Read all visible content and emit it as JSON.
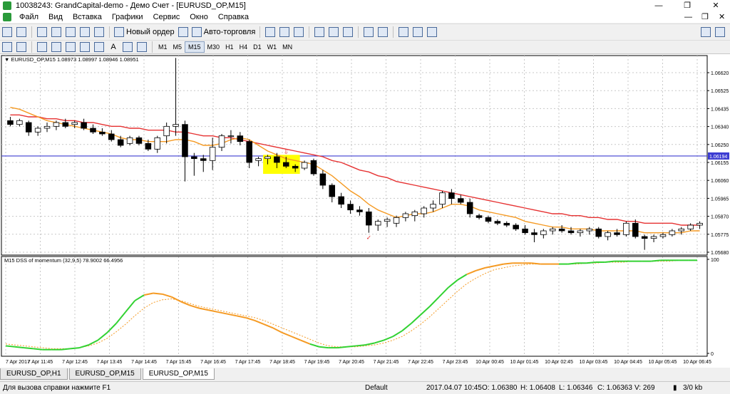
{
  "window": {
    "title": "10038243: GrandCapital-demo - Демо Счет - [EURUSD_OP,M15]",
    "minimize": "—",
    "maximize": "❐",
    "close": "✕"
  },
  "menu": {
    "items": [
      "Файл",
      "Вид",
      "Вставка",
      "Графики",
      "Сервис",
      "Окно",
      "Справка"
    ],
    "right_min": "—",
    "right_restore": "❐",
    "right_close": "✕"
  },
  "toolbar": {
    "new_order": "Новый ордер",
    "auto_trading": "Авто-торговля",
    "timeframes": [
      "M1",
      "M5",
      "M15",
      "M30",
      "H1",
      "H4",
      "D1",
      "W1",
      "MN"
    ],
    "draw_text_tool": "A"
  },
  "colors": {
    "bull": "#ffffff",
    "bear": "#000000",
    "ma_fast": "#f59a23",
    "ma_slow": "#e63232",
    "hline": "#3c3cd2",
    "osc_main_green": "#32d232",
    "osc_main_orange": "#f59a23",
    "highlight": "#ffff00"
  },
  "chart_data": [
    {
      "type": "candlestick",
      "title": "EURUSD_OP,M15",
      "ohlc_header": "1.08973 1.08997 1.08946 1.08951",
      "ylim": [
        1.0568,
        1.067
      ],
      "y_ticks": [
        "1.06620",
        "1.06525",
        "1.06435",
        "1.06340",
        "1.06250",
        "1.06155",
        "1.06060",
        "1.05965",
        "1.05870",
        "1.05775",
        "1.05680"
      ],
      "hline_value": "1.06194",
      "candles": [
        [
          1.0638,
          1.064,
          1.0635,
          1.0636
        ],
        [
          1.0636,
          1.0639,
          1.0635,
          1.0638
        ],
        [
          1.0637,
          1.0638,
          1.063,
          1.0632
        ],
        [
          1.0632,
          1.0635,
          1.063,
          1.0634
        ],
        [
          1.0634,
          1.0637,
          1.0632,
          1.0635
        ],
        [
          1.0635,
          1.0638,
          1.0633,
          1.0637
        ],
        [
          1.0637,
          1.0639,
          1.0634,
          1.0635
        ],
        [
          1.0636,
          1.0638,
          1.0634,
          1.0637
        ],
        [
          1.0637,
          1.0639,
          1.0633,
          1.0634
        ],
        [
          1.0634,
          1.0636,
          1.0631,
          1.0632
        ],
        [
          1.0632,
          1.0634,
          1.063,
          1.0631
        ],
        [
          1.0631,
          1.0633,
          1.0627,
          1.0628
        ],
        [
          1.0628,
          1.063,
          1.0624,
          1.0625
        ],
        [
          1.0626,
          1.063,
          1.0625,
          1.0629
        ],
        [
          1.0629,
          1.063,
          1.0625,
          1.0626
        ],
        [
          1.0626,
          1.0628,
          1.0622,
          1.0623
        ],
        [
          1.0623,
          1.063,
          1.0621,
          1.0629
        ],
        [
          1.063,
          1.0637,
          1.0626,
          1.0635
        ],
        [
          1.0635,
          1.0671,
          1.063,
          1.0636
        ],
        [
          1.0636,
          1.0638,
          1.0606,
          1.0619
        ],
        [
          1.0619,
          1.0621,
          1.0609,
          1.0618
        ],
        [
          1.0618,
          1.062,
          1.0611,
          1.0617
        ],
        [
          1.0617,
          1.0629,
          1.0612,
          1.0624
        ],
        [
          1.0624,
          1.0631,
          1.0622,
          1.063
        ],
        [
          1.063,
          1.0633,
          1.0626,
          1.063
        ],
        [
          1.063,
          1.0632,
          1.0625,
          1.0627
        ],
        [
          1.0627,
          1.0628,
          1.0613,
          1.0616
        ],
        [
          1.0617,
          1.0619,
          1.0614,
          1.0618
        ],
        [
          1.0618,
          1.062,
          1.0615,
          1.0619
        ],
        [
          1.0619,
          1.0621,
          1.0613,
          1.0616
        ],
        [
          1.0616,
          1.0619,
          1.0613,
          1.0614
        ],
        [
          1.0614,
          1.0615,
          1.0611,
          1.0613
        ],
        [
          1.0613,
          1.0617,
          1.0612,
          1.0616
        ],
        [
          1.0617,
          1.0618,
          1.0609,
          1.061
        ],
        [
          1.061,
          1.0612,
          1.0602,
          1.0604
        ],
        [
          1.0604,
          1.0605,
          1.0595,
          1.0598
        ],
        [
          1.0598,
          1.06,
          1.0592,
          1.0594
        ],
        [
          1.0594,
          1.0596,
          1.0589,
          1.0591
        ],
        [
          1.0591,
          1.0593,
          1.0588,
          1.059
        ],
        [
          1.059,
          1.0592,
          1.0579,
          1.0583
        ],
        [
          1.0583,
          1.0586,
          1.058,
          1.0585
        ],
        [
          1.0585,
          1.0587,
          1.0582,
          1.0586
        ],
        [
          1.0584,
          1.0588,
          1.0582,
          1.0587
        ],
        [
          1.0587,
          1.059,
          1.0585,
          1.0589
        ],
        [
          1.0588,
          1.0591,
          1.0585,
          1.059
        ],
        [
          1.0589,
          1.0593,
          1.0587,
          1.0592
        ],
        [
          1.0592,
          1.0596,
          1.059,
          1.0594
        ],
        [
          1.0594,
          1.0601,
          1.0592,
          1.06
        ],
        [
          1.06,
          1.0602,
          1.0594,
          1.0597
        ],
        [
          1.0597,
          1.0599,
          1.0594,
          1.0595
        ],
        [
          1.0595,
          1.0597,
          1.0587,
          1.0589
        ],
        [
          1.0588,
          1.0589,
          1.0586,
          1.0587
        ],
        [
          1.0587,
          1.0588,
          1.0584,
          1.0585
        ],
        [
          1.0585,
          1.0586,
          1.0583,
          1.0584
        ],
        [
          1.0584,
          1.0585,
          1.0582,
          1.0583
        ],
        [
          1.0583,
          1.0584,
          1.058,
          1.0581
        ],
        [
          1.0581,
          1.0583,
          1.0578,
          1.0579
        ],
        [
          1.0579,
          1.0581,
          1.0574,
          1.0578
        ],
        [
          1.0578,
          1.0581,
          1.0576,
          1.058
        ],
        [
          1.058,
          1.0582,
          1.0578,
          1.0581
        ],
        [
          1.0581,
          1.0583,
          1.0579,
          1.058
        ],
        [
          1.058,
          1.0582,
          1.0578,
          1.0579
        ],
        [
          1.0579,
          1.0581,
          1.0577,
          1.058
        ],
        [
          1.058,
          1.0582,
          1.0578,
          1.0581
        ],
        [
          1.0581,
          1.0582,
          1.0576,
          1.0577
        ],
        [
          1.0577,
          1.058,
          1.0575,
          1.0579
        ],
        [
          1.0579,
          1.0581,
          1.0577,
          1.0578
        ],
        [
          1.0578,
          1.0585,
          1.0577,
          1.0584
        ],
        [
          1.0584,
          1.0586,
          1.0576,
          1.0577
        ],
        [
          1.0577,
          1.0578,
          1.057,
          1.0576
        ],
        [
          1.0576,
          1.0578,
          1.0574,
          1.0577
        ],
        [
          1.0577,
          1.0579,
          1.0576,
          1.0578
        ],
        [
          1.0578,
          1.0581,
          1.0577,
          1.058
        ],
        [
          1.058,
          1.0582,
          1.0578,
          1.0581
        ],
        [
          1.0581,
          1.0584,
          1.058,
          1.0583
        ],
        [
          1.0583,
          1.0585,
          1.0581,
          1.0584
        ]
      ],
      "ma_fast": [
        1.0645,
        1.0644,
        1.0642,
        1.064,
        1.0638,
        1.0637,
        1.0636,
        1.0635,
        1.0634,
        1.0633,
        1.0632,
        1.0631,
        1.0629,
        1.0628,
        1.0628,
        1.0627,
        1.0627,
        1.0627,
        1.0628,
        1.0628,
        1.0627,
        1.0625,
        1.0625,
        1.0626,
        1.0628,
        1.0629,
        1.0628,
        1.0625,
        1.0622,
        1.062,
        1.0618,
        1.0617,
        1.0616,
        1.0615,
        1.0612,
        1.0609,
        1.0605,
        1.0601,
        1.0598,
        1.0594,
        1.0591,
        1.0589,
        1.0587,
        1.0588,
        1.0589,
        1.0589,
        1.059,
        1.0592,
        1.0594,
        1.0594,
        1.0593,
        1.0591,
        1.059,
        1.0589,
        1.0588,
        1.0587,
        1.0585,
        1.0584,
        1.0583,
        1.0582,
        1.0582,
        1.0581,
        1.0581,
        1.0581,
        1.058,
        1.058,
        1.058,
        1.058,
        1.058,
        1.0579,
        1.0579,
        1.0579,
        1.0579,
        1.0579,
        1.058,
        1.058
      ],
      "ma_slow": [
        1.0641,
        1.0641,
        1.064,
        1.064,
        1.0639,
        1.0639,
        1.0638,
        1.0638,
        1.0637,
        1.0637,
        1.0636,
        1.0635,
        1.0635,
        1.0634,
        1.0634,
        1.0633,
        1.0633,
        1.0633,
        1.0632,
        1.0632,
        1.0631,
        1.063,
        1.063,
        1.0629,
        1.0629,
        1.0628,
        1.0627,
        1.0626,
        1.0625,
        1.0624,
        1.0623,
        1.0622,
        1.0621,
        1.062,
        1.0619,
        1.0617,
        1.0616,
        1.0614,
        1.0612,
        1.0611,
        1.0609,
        1.0608,
        1.0606,
        1.0605,
        1.0604,
        1.0603,
        1.0602,
        1.0601,
        1.06,
        1.0599,
        1.0598,
        1.0597,
        1.0596,
        1.0595,
        1.0594,
        1.0593,
        1.0592,
        1.0591,
        1.059,
        1.0589,
        1.0589,
        1.0588,
        1.0588,
        1.0587,
        1.0587,
        1.0586,
        1.0586,
        1.0585,
        1.0585,
        1.0584,
        1.0584,
        1.0584,
        1.0584,
        1.0583,
        1.0583,
        1.0583
      ],
      "highlight_range": [
        28,
        31
      ],
      "down_arrow_index": 30,
      "check_mark_index": 39,
      "x_ticks": [
        "7 Apr 2017",
        "7 Apr 11:45",
        "7 Apr 12:45",
        "7 Apr 13:45",
        "7 Apr 14:45",
        "7 Apr 15:45",
        "7 Apr 16:45",
        "7 Apr 17:45",
        "7 Apr 18:45",
        "7 Apr 19:45",
        "7 Apr 20:45",
        "7 Apr 21:45",
        "7 Apr 22:45",
        "7 Apr 23:45",
        "10 Apr 00:45",
        "10 Apr 01:45",
        "10 Apr 02:45",
        "10 Apr 03:45",
        "10 Apr 04:45",
        "10 Apr 05:45",
        "10 Apr 06:45"
      ]
    },
    {
      "type": "line",
      "title": "M15 DSS of momentum (32,9,5) 78.9002 66.4956",
      "ylim": [
        0,
        100
      ],
      "y_ticks": [
        "100",
        "0"
      ],
      "main": [
        8,
        7,
        6,
        5,
        4,
        4,
        4,
        5,
        6,
        9,
        14,
        22,
        32,
        44,
        56,
        62,
        64,
        63,
        60,
        55,
        51,
        48,
        46,
        44,
        42,
        40,
        38,
        35,
        31,
        27,
        22,
        18,
        14,
        10,
        7,
        6,
        6,
        7,
        8,
        9,
        11,
        14,
        18,
        24,
        32,
        41,
        50,
        60,
        70,
        78,
        84,
        88,
        91,
        93,
        95,
        96,
        96,
        96,
        95,
        95,
        95,
        95,
        96,
        96,
        97,
        97,
        98,
        98,
        98,
        98,
        98,
        99,
        99,
        99,
        99,
        99
      ],
      "signal": [
        10,
        9,
        8,
        7,
        6,
        5,
        5,
        5,
        6,
        8,
        11,
        16,
        23,
        31,
        40,
        48,
        54,
        57,
        58,
        56,
        53,
        50,
        48,
        46,
        44,
        42,
        40,
        38,
        35,
        31,
        27,
        23,
        19,
        15,
        11,
        8,
        7,
        7,
        7,
        8,
        9,
        11,
        14,
        18,
        24,
        31,
        39,
        48,
        57,
        66,
        74,
        80,
        85,
        89,
        91,
        93,
        94,
        95,
        95,
        95,
        95,
        95,
        95,
        96,
        96,
        97,
        97,
        97,
        98,
        98,
        98,
        98,
        98,
        99,
        99,
        99
      ],
      "orange_ranges": [
        [
          15,
          33
        ],
        [
          50,
          60
        ]
      ]
    }
  ],
  "tabs": [
    "EURUSD_OP,H1",
    "EURUSD_OP,M15",
    "EURUSD_OP,M15"
  ],
  "status": {
    "help": "Для вызова справки нажмите F1",
    "profile": "Default",
    "datetime": "2017.04.07 10:45",
    "open": "O: 1.06380",
    "high": "H: 1.06408",
    "low": "L: 1.06346",
    "close": "C: 1.06363",
    "volume": "V: 269",
    "traffic": "3/0 kb"
  }
}
